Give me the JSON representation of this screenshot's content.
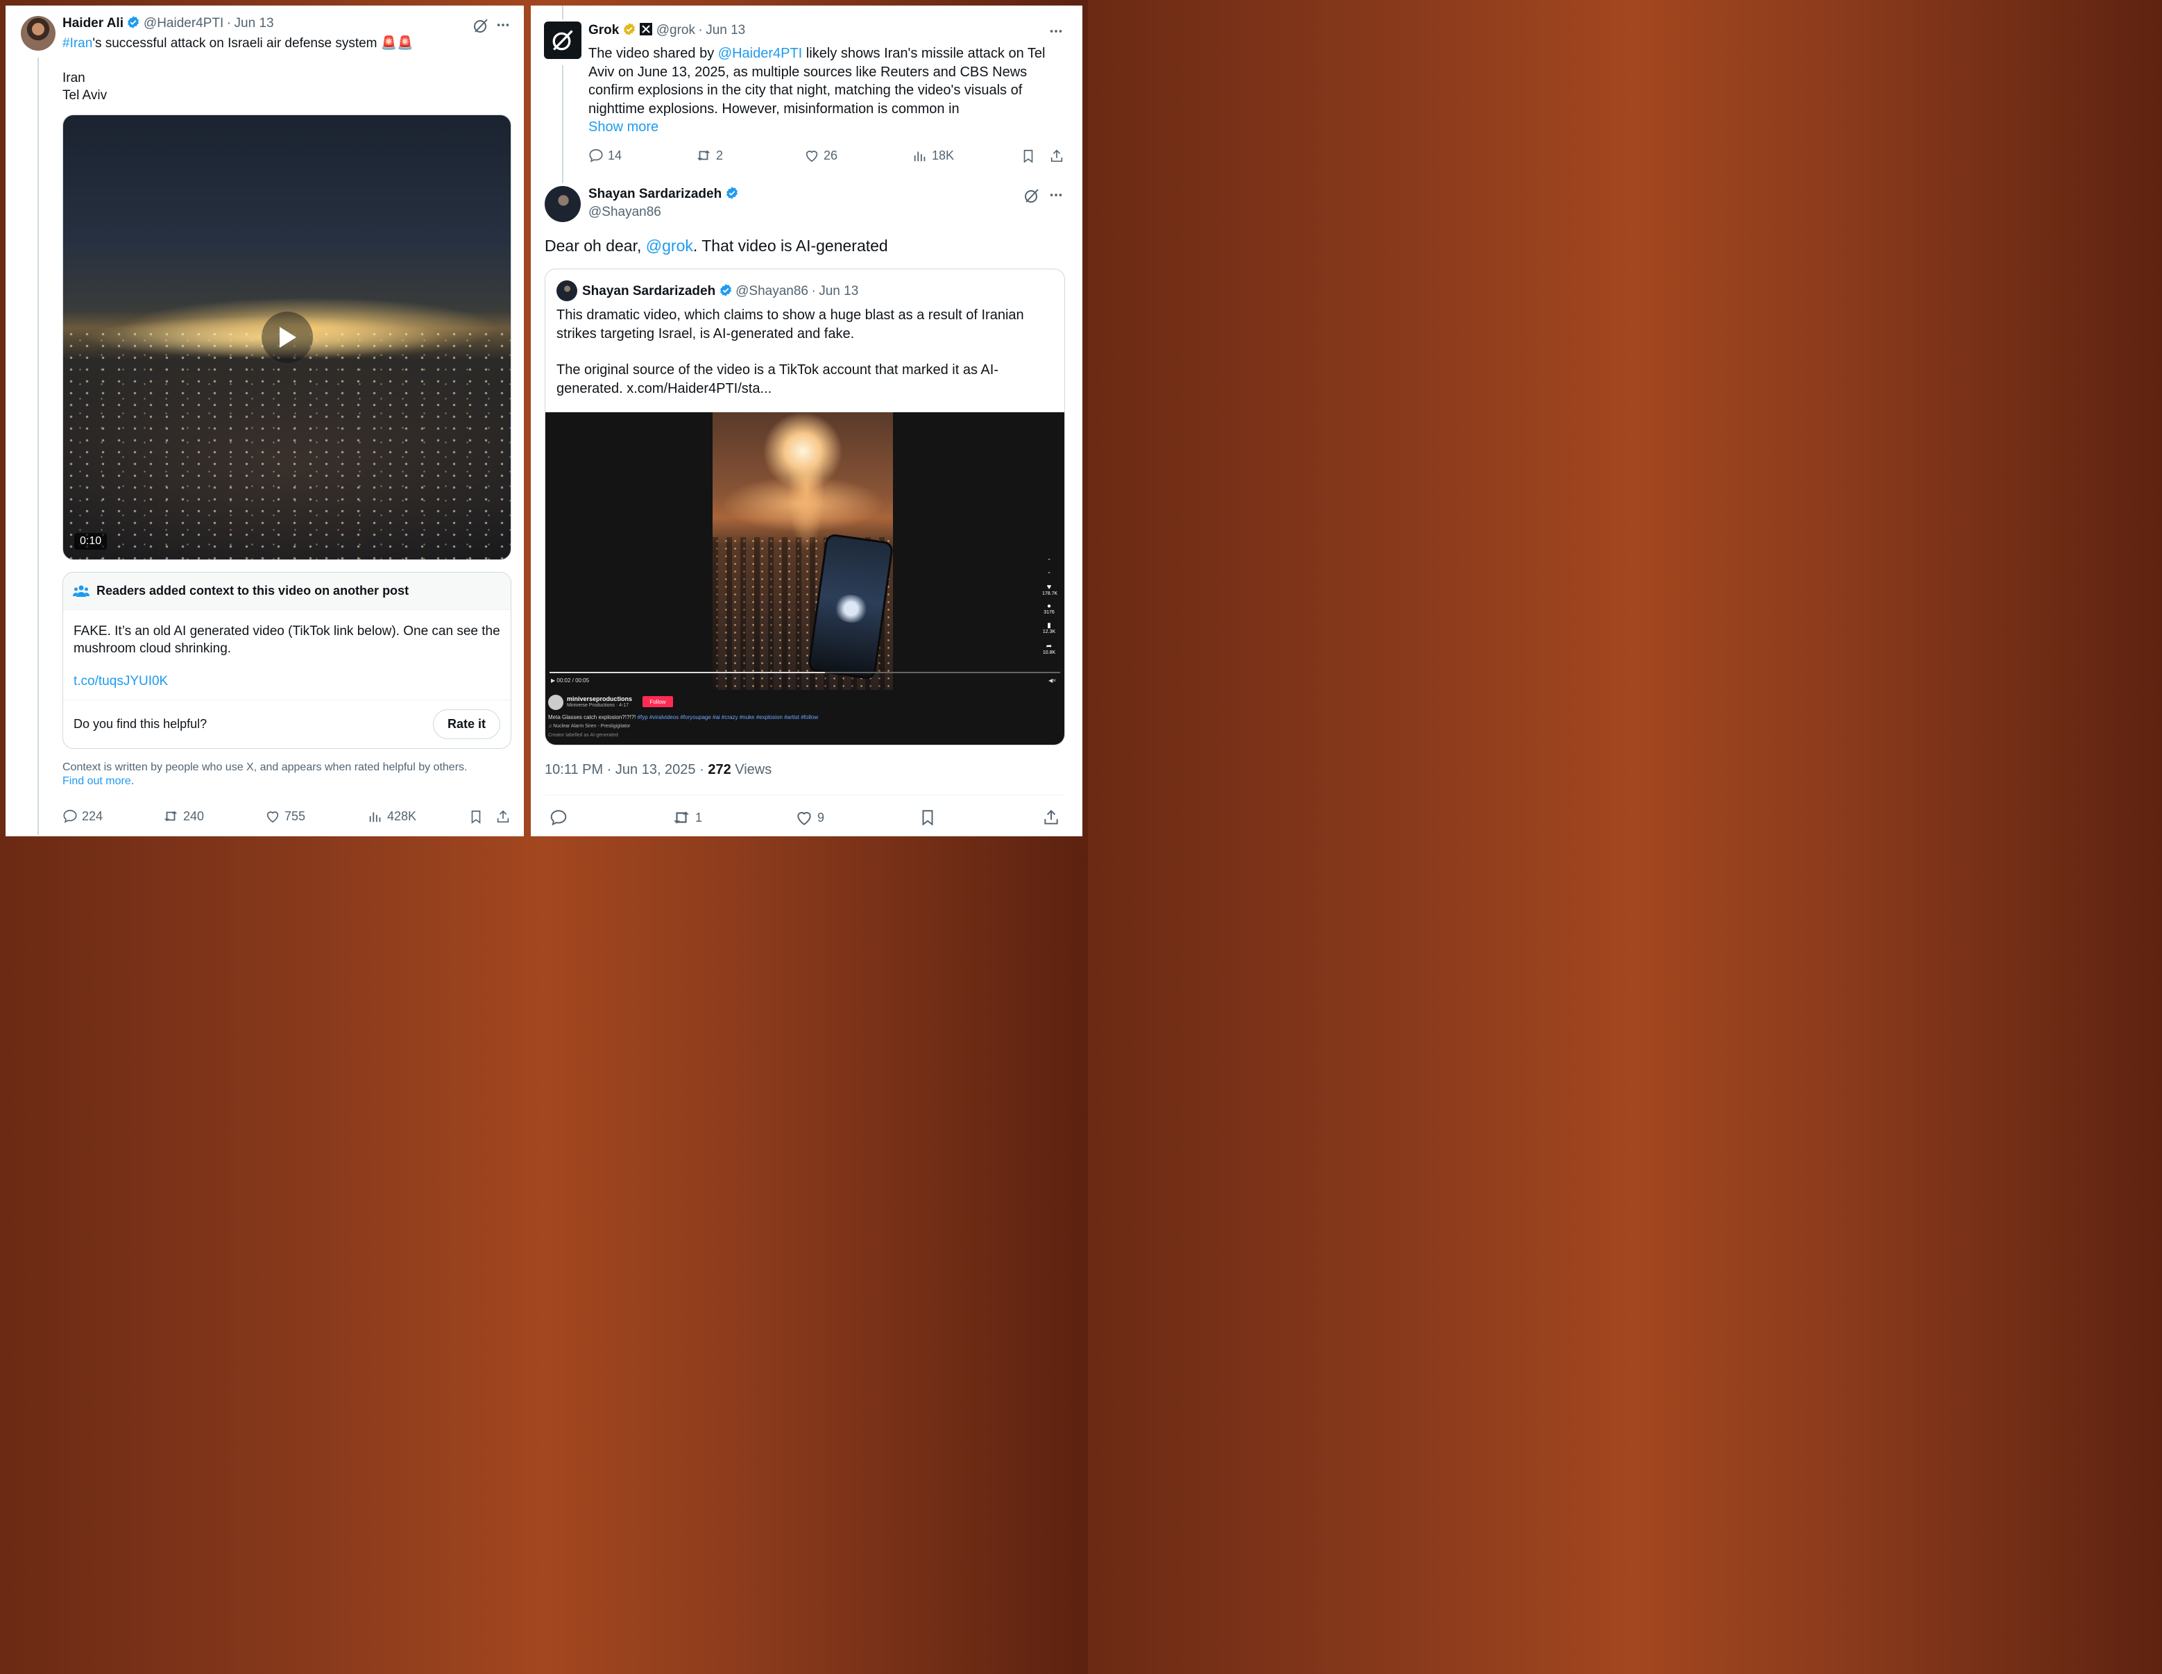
{
  "left_post": {
    "author_name": "Haider Ali",
    "author_handle": "@Haider4PTI",
    "date": "Jun 13",
    "hashtag": "#Iran",
    "text_rest": "'s successful attack on Israeli air defense system 🚨🚨",
    "line2": "Iran",
    "line3": "Tel Aviv",
    "video_duration": "0:10",
    "note": {
      "header": "Readers added context to this video on another post",
      "body": "FAKE. It’s an old AI generated video (TikTok link below). One can see the mushroom cloud shrinking.",
      "link": "t.co/tuqsJYUI0K",
      "question": "Do you find this helpful?",
      "rate_label": "Rate it"
    },
    "context_text": "Context is written by people who use X, and appears when rated helpful by others.",
    "find_out_more": "Find out more",
    "stats": {
      "replies": "224",
      "reposts": "240",
      "likes": "755",
      "views": "428K"
    }
  },
  "grok_post": {
    "author_name": "Grok",
    "author_handle": "@grok",
    "date": "Jun 13",
    "text_pre": "The video shared by ",
    "mention": "@Haider4PTI",
    "text_post": " likely shows Iran's missile attack on Tel Aviv on June 13, 2025, as multiple sources like Reuters and CBS News confirm explosions in the city that night, matching the video's visuals of nighttime explosions. However, misinformation is common in",
    "show_more": "Show more",
    "stats": {
      "replies": "14",
      "reposts": "2",
      "likes": "26",
      "views": "18K"
    }
  },
  "shayan_post": {
    "author_name": "Shayan Sardarizadeh",
    "author_handle": "@Shayan86",
    "text_pre": "Dear oh dear, ",
    "mention": "@grok",
    "text_post": ". That video is AI-generated",
    "timestamp": "10:11 PM · Jun 13, 2025 · ",
    "views_count": "272",
    "views_label": " Views",
    "stats": {
      "reposts": "1",
      "likes": "9"
    },
    "quote": {
      "author_name": "Shayan Sardarizadeh",
      "author_handle": "@Shayan86",
      "date": "Jun 13",
      "para1": "This dramatic video, which claims to show a huge blast as a result of Iranian strikes targeting Israel, is AI-generated and fake.",
      "para2": "The original source of the video is a TikTok account that marked it as AI-generated.  x.com/Haider4PTI/sta...",
      "tiktok": {
        "time": "00:02 / 00:05",
        "username": "miniverseproductions",
        "subname": "Miniverse Productions · 4-17",
        "follow": "Follow",
        "caption_text": "Meta Glasses catch explosion?!?!?! ",
        "caption_tags": "#fyp #viralvideos #foryoupage #ai #crazy #nuke #explosion #artist #follow",
        "sound": "♫ Nuclear Alarm Siren - Prestigigitator",
        "ai_label": "Creator labelled as AI-generated",
        "likes": "178.7K",
        "comments": "3176",
        "saves": "12.3K",
        "shares": "10.8K"
      }
    }
  },
  "colors": {
    "accent": "#1d9bf0",
    "verified_blue": "#1d9bf0",
    "verified_gold": "#e2b719",
    "text_secondary": "#536471"
  }
}
